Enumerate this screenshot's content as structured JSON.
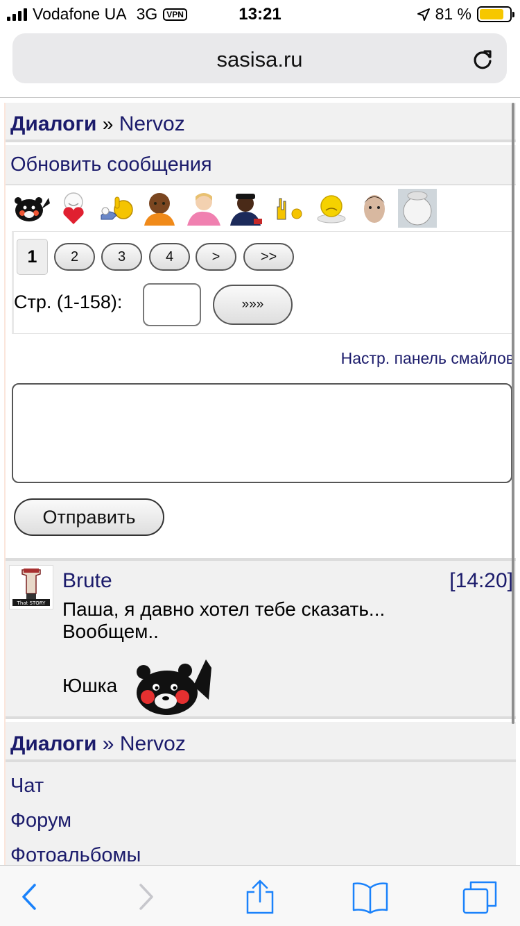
{
  "status_bar": {
    "carrier": "Vodafone UA",
    "network": "3G",
    "vpn": "VPN",
    "time": "13:21",
    "battery": "81 %",
    "battery_level": 0.81
  },
  "browser": {
    "url": "sasisa.ru"
  },
  "breadcrumb": {
    "parent": "Диалоги",
    "separator": "»",
    "current": "Nervoz"
  },
  "update_link": "Обновить сообщения",
  "smileys": [
    "kumamon",
    "heart-smiley",
    "thumbs-smiley",
    "brown-man",
    "pink-girl",
    "police-man",
    "rock-smiley",
    "yellow-cry",
    "durov",
    "grey-ghost"
  ],
  "pager": {
    "current": "1",
    "pages": [
      "2",
      "3",
      "4"
    ],
    "next": ">",
    "last": ">>",
    "goto_label": "Стр. (1-158):",
    "goto_button": "»»»"
  },
  "smile_settings_link": "Настр. панель смайлов",
  "message_input": {
    "value": "",
    "placeholder": ""
  },
  "send_button": "Отправить",
  "messages": [
    {
      "author": "Brute",
      "time": "[14:20]",
      "text_line1": "Паша, я давно хотел тебе сказать...",
      "text_line2": "Вообщем..",
      "signature": "Юшка",
      "avatar_text": "That STORY"
    }
  ],
  "footer_nav": {
    "links": [
      "Чат",
      "Форум",
      "Фотоальбомы"
    ]
  },
  "colors": {
    "link": "#1b1b6b",
    "panel": "#f1f1f1",
    "battery": "#f6c700",
    "ios_blue": "#1a82fb"
  }
}
